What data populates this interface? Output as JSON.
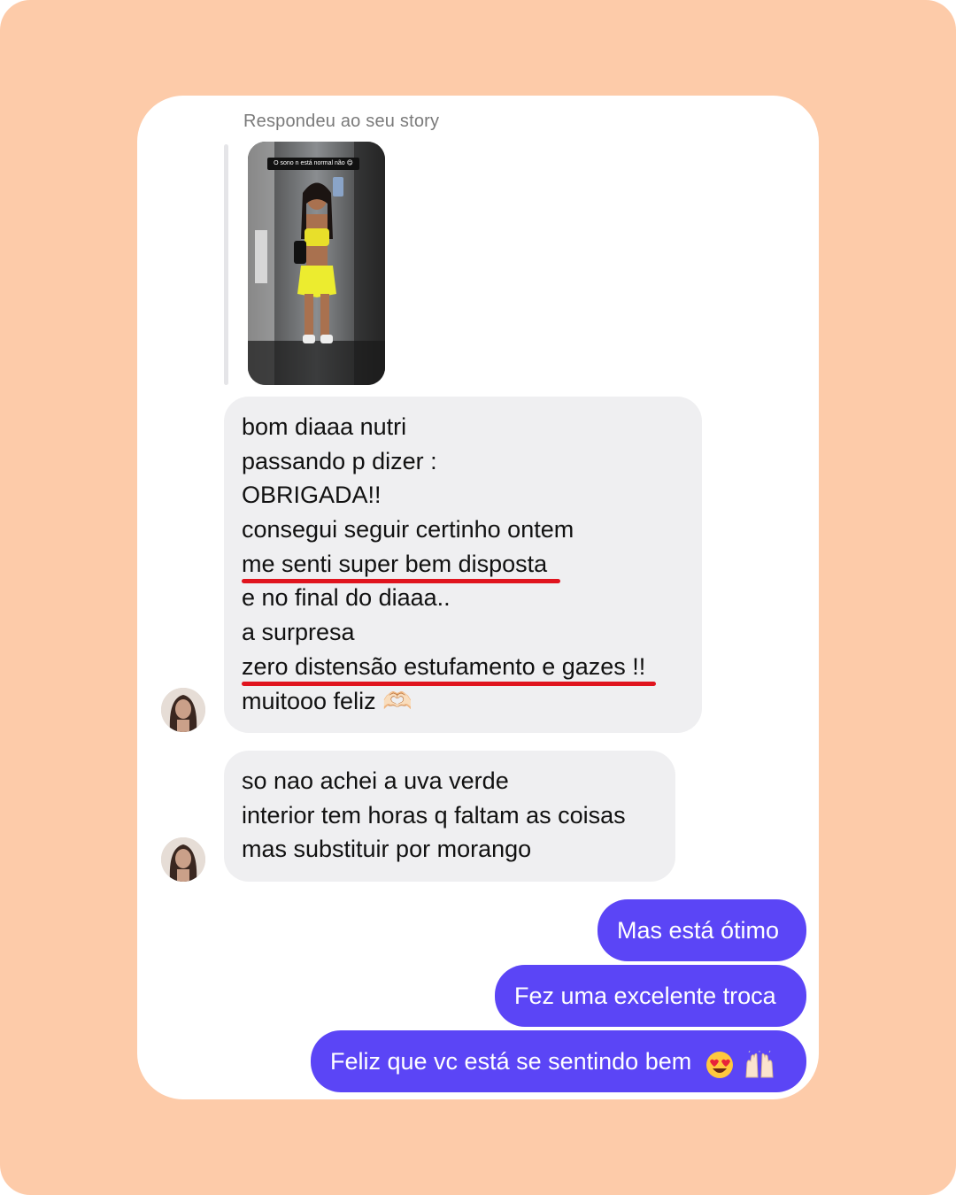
{
  "story": {
    "caption": "Respondeu ao seu story",
    "overlay_text": "O sono n está normal não 😋"
  },
  "messages_received": [
    {
      "lines": [
        "bom diaaa nutri",
        "passando p dizer :",
        "OBRIGADA!!",
        "consegui seguir certinho ontem",
        "me senti super bem disposta",
        "e no final do diaaa..",
        "a surpresa",
        "zero distensão estufamento  e gazes !!",
        "muitooo feliz 🫶🏻"
      ],
      "underlined_lines": [
        4,
        7
      ]
    },
    {
      "lines": [
        "so nao achei a uva verde",
        "interior tem horas q faltam as coisas",
        "mas substituir por morango"
      ]
    }
  ],
  "messages_sent": [
    {
      "text": "Mas está ótimo"
    },
    {
      "text": "Fez uma excelente troca"
    },
    {
      "text": "Feliz que vc está se sentindo bem"
    }
  ],
  "emojis": [
    "heart-eyes-emoji",
    "raising-hands-emoji"
  ],
  "colors": {
    "background": "#FDCBA9",
    "card": "#FFFFFF",
    "incoming_bubble": "#EFEFF1",
    "outgoing_bubble": "#5B45F6",
    "underline": "#E0141E"
  }
}
